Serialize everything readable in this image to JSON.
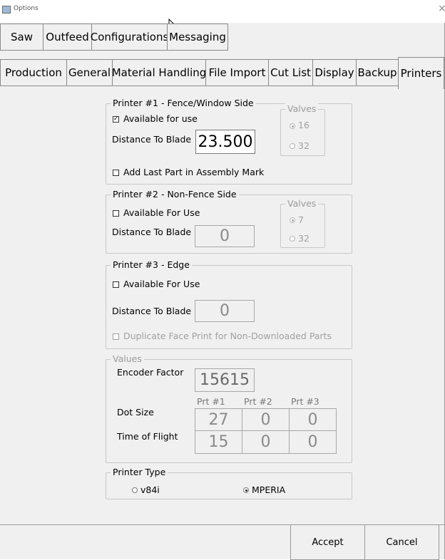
{
  "window": {
    "title": "Options",
    "close_glyph": "×",
    "icon": "app-options-icon"
  },
  "tabs_row1": [
    "Saw",
    "Outfeed",
    "Configurations",
    "Messaging"
  ],
  "tabs_row2": [
    "Production",
    "General",
    "Material Handling",
    "File Import",
    "Cut List",
    "Display",
    "Backup",
    "Printers"
  ],
  "active_tab": "Printers",
  "printer1": {
    "title": "Printer #1  -  Fence/Window Side",
    "available_label": "Available for use",
    "available_checked": "✓",
    "distance_label": "Distance To Blade",
    "distance_value": "23.500",
    "add_last_part_label": "Add Last Part in Assembly Mark",
    "valves_title": "Valves",
    "valve_a": "16",
    "valve_b": "32"
  },
  "printer2": {
    "title": "Printer #2  -  Non-Fence Side",
    "available_label": "Available For Use",
    "distance_label": "Distance To Blade",
    "distance_value": "0",
    "valves_title": "Valves",
    "valve_a": "7",
    "valve_b": "32"
  },
  "printer3": {
    "title": "Printer #3  -  Edge",
    "available_label": "Available For Use",
    "distance_label": "Distance To Blade",
    "distance_value": "0",
    "duplicate_label": "Duplicate Face Print for Non-Downloaded Parts"
  },
  "values": {
    "title": "Values",
    "encoder_label": "Encoder Factor",
    "encoder_value": "15615",
    "col_headers": [
      "Prt #1",
      "Prt #2",
      "Prt #3"
    ],
    "dot_size_label": "Dot Size",
    "dot_size": [
      "27",
      "0",
      "0"
    ],
    "tof_label": "Time of Flight",
    "tof": [
      "15",
      "0",
      "0"
    ]
  },
  "printer_type": {
    "title": "Printer Type",
    "opt1": "v84i",
    "opt2": "MPERIA",
    "selected": "MPERIA"
  },
  "buttons": {
    "accept": "Accept",
    "cancel": "Cancel"
  }
}
